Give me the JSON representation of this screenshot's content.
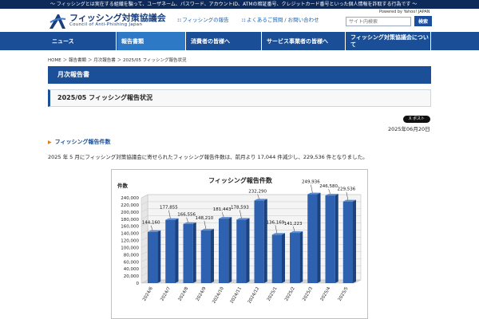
{
  "topbar": {
    "text": "～ フィッシングとは実在する組織を騙って、ユーザネーム、パスワード、アカウントID、ATMの暗証番号、クレジットカード番号といった個人情報を詐取する行為です ～"
  },
  "header": {
    "title": "フィッシング対策協議会",
    "subtitle": "Council of Anti-Phishing Japan",
    "links": [
      {
        "icon": "::",
        "label": "フィッシングの報告"
      },
      {
        "icon": "::",
        "label": "よくあるご質問 / お問い合わせ"
      }
    ],
    "powered": "Powered by Yahoo! JAPAN",
    "search_placeholder": "サイト内検索",
    "search_button": "検索"
  },
  "nav": [
    {
      "label": "ニュース",
      "arrow": "",
      "active": false
    },
    {
      "label": "報告書類",
      "arrow": "",
      "active": true
    },
    {
      "label": "消費者の皆様へ",
      "arrow": "",
      "active": false
    },
    {
      "label": "サービス事業者の皆様へ",
      "arrow": "",
      "active": false
    },
    {
      "label": "フィッシング対策協議会について",
      "arrow": "",
      "active": false
    }
  ],
  "breadcrumb": [
    "HOME",
    "報告書類",
    "月次報告書",
    "2025/05 フィッシング報告状況"
  ],
  "page_title": "月次報告書",
  "article_title": "2025/05 フィッシング報告状況",
  "post_button": "X ポスト",
  "date": "2025年06月20日",
  "section_heading": "フィッシング報告件数",
  "paragraph": "2025 年 5 月にフィッシング対策協議会に寄せられたフィッシング報告件数は、前月より 17,044 件減少し、229,536 件となりました。",
  "colors": {
    "nav": "#1a4f98",
    "nav_active": "#2e79c6",
    "bar": "#2e62b0",
    "accent": "#e07a16"
  },
  "chart_data": {
    "type": "bar",
    "title": "フィッシング報告件数",
    "ylabel": "件数",
    "categories": [
      "2024/6",
      "2024/7",
      "2024/8",
      "2024/9",
      "2024/10",
      "2024/11",
      "2024/12",
      "2025/1",
      "2025/2",
      "2025/3",
      "2025/4",
      "2025/5"
    ],
    "values": [
      144160,
      177855,
      166556,
      148210,
      181443,
      178593,
      232290,
      136169,
      141223,
      249936,
      246580,
      229536
    ],
    "value_labels": [
      "144,160",
      "177,855",
      "166,556",
      "148,210",
      "181,443",
      "178,593",
      "232,290",
      "136,169",
      "141,223",
      "249,936",
      "246,580",
      "229,536"
    ],
    "yticks": [
      "0",
      "20,000",
      "40,000",
      "60,000",
      "80,000",
      "100,000",
      "120,000",
      "140,000",
      "160,000",
      "180,000",
      "200,000",
      "220,000",
      "240,000"
    ],
    "ylim": [
      0,
      240000
    ],
    "grid": true
  }
}
